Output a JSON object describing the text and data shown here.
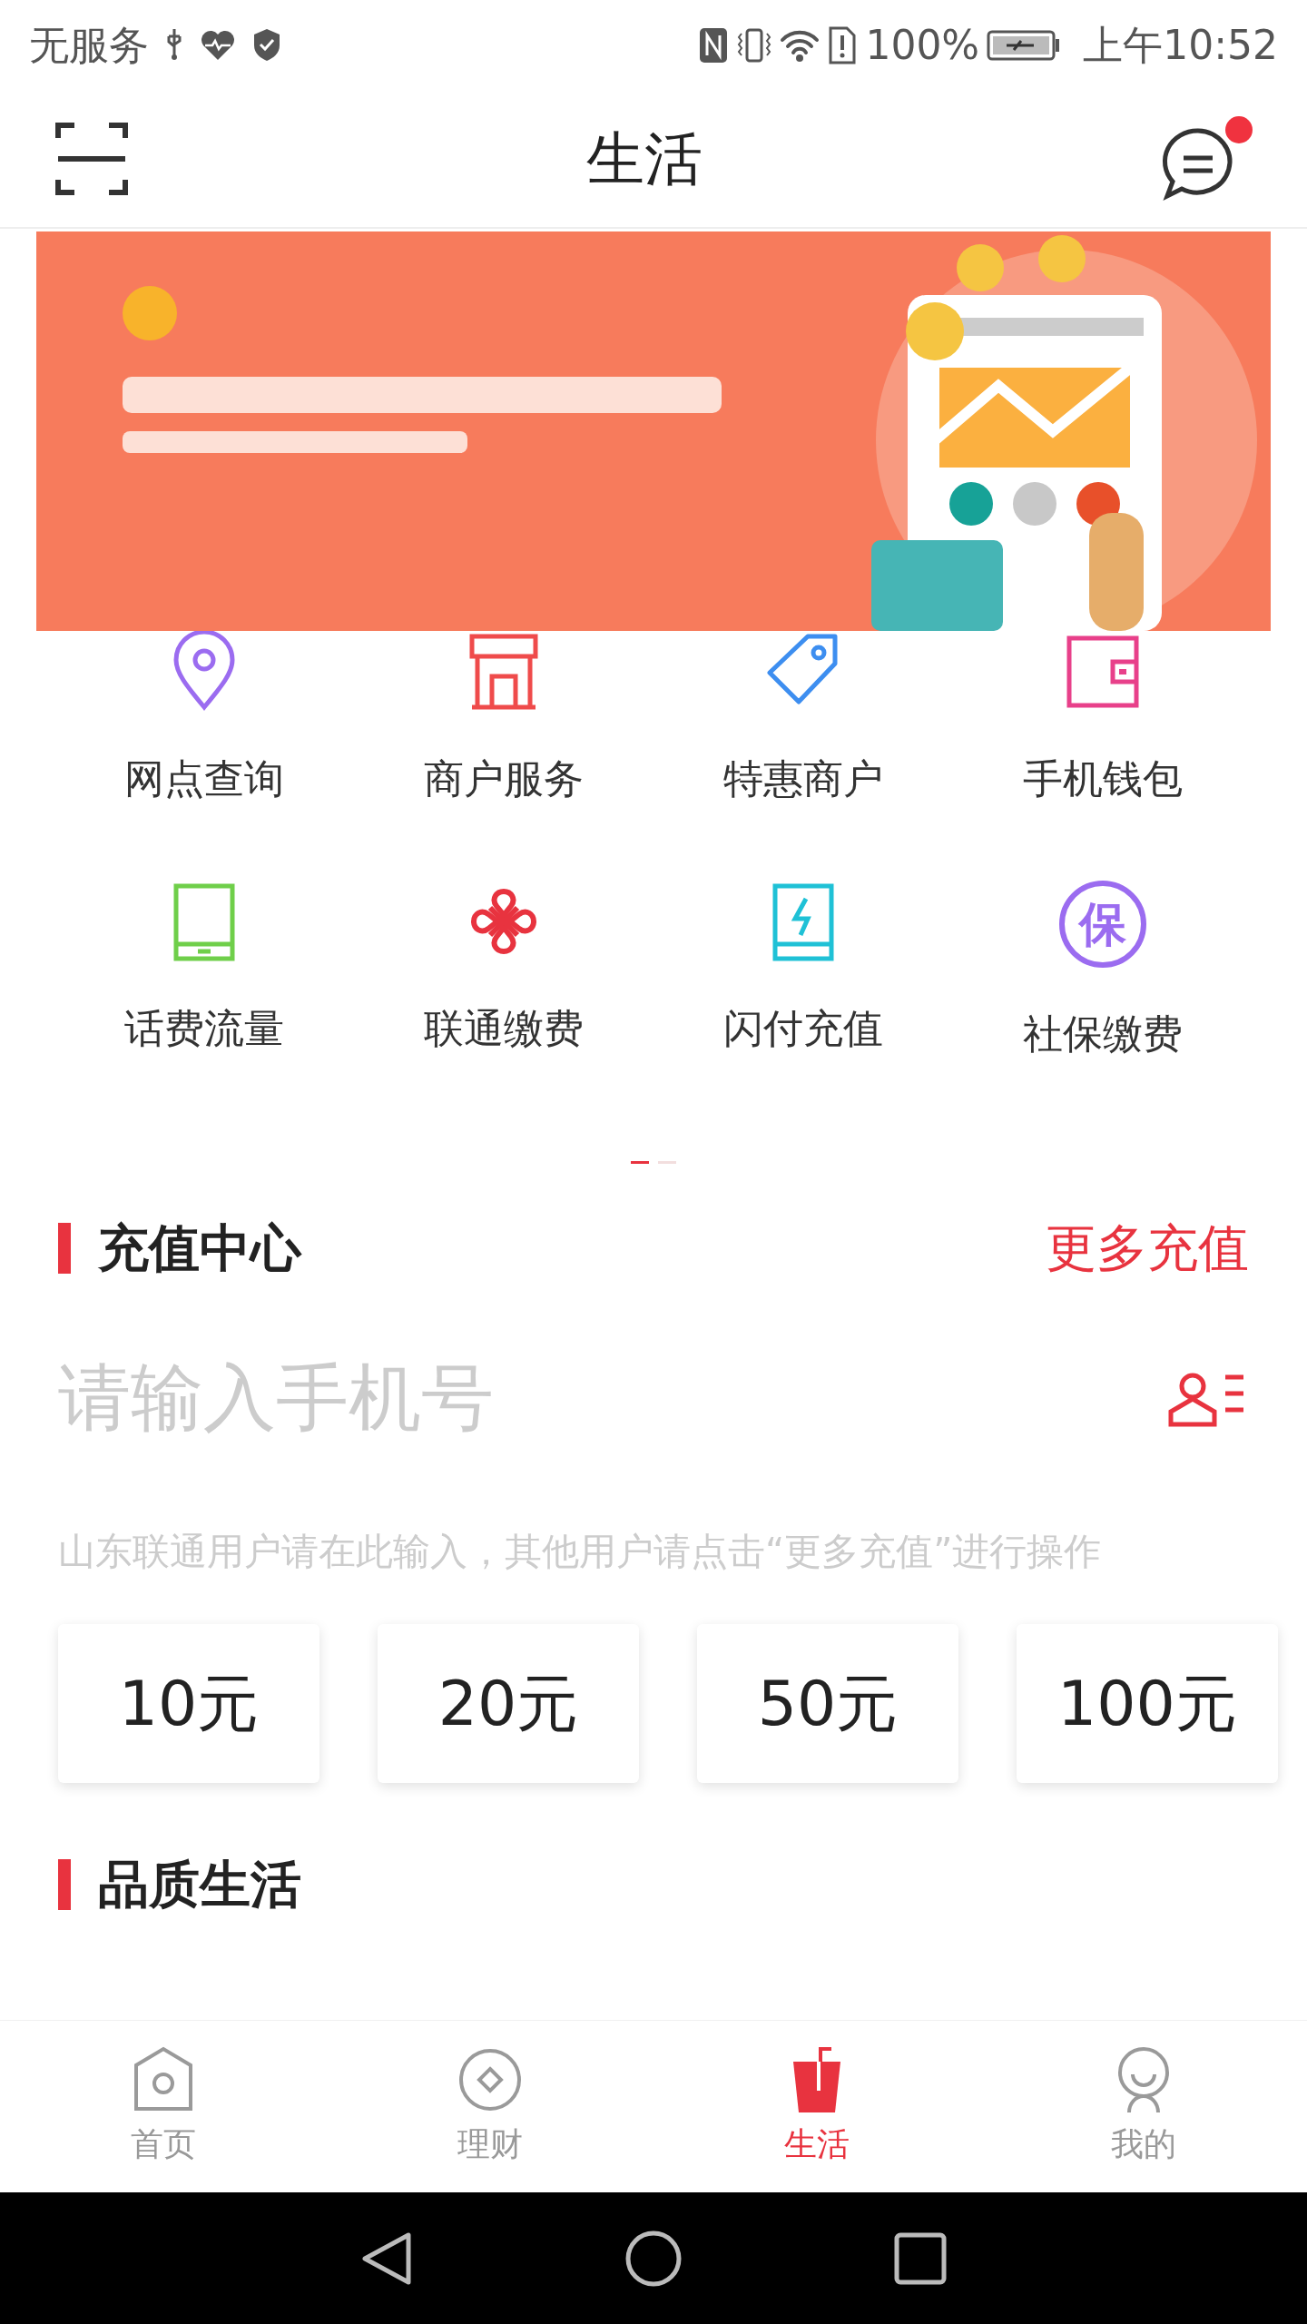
{
  "status_bar": {
    "carrier": "无服务",
    "battery": "100%",
    "time": "上午10:52"
  },
  "header": {
    "title": "生活",
    "has_unread": true
  },
  "services": [
    {
      "label": "网点查询",
      "kind": "pin",
      "color": "#9b6cf0"
    },
    {
      "label": "商户服务",
      "kind": "store",
      "color": "#ef4b4b"
    },
    {
      "label": "特惠商户",
      "kind": "tag",
      "color": "#3d8ef0"
    },
    {
      "label": "手机钱包",
      "kind": "wallet",
      "color": "#e8408a"
    },
    {
      "label": "话费流量",
      "kind": "tablet",
      "color": "#6fcf4a"
    },
    {
      "label": "联通缴费",
      "kind": "knot",
      "color": "#e8333f"
    },
    {
      "label": "闪付充值",
      "kind": "bolt",
      "color": "#1fc1d6"
    },
    {
      "label": "社保缴费",
      "kind": "seal",
      "icon_text": "保",
      "color": "#9b6cf0"
    }
  ],
  "pager": [
    {
      "selected": true
    },
    {
      "selected": false
    }
  ],
  "recharge": {
    "title": "充值中心",
    "more": "更多充值",
    "placeholder": "请输入手机号",
    "hint": "山东联通用户请在此输入，其他用户请点击“更多充值”进行操作",
    "amounts": [
      "10元",
      "20元",
      "50元",
      "100元"
    ]
  },
  "next_section": {
    "title": "品质生活"
  },
  "tab_bar": [
    {
      "label": "首页",
      "kind": "home",
      "selected": false
    },
    {
      "label": "理财",
      "kind": "coin",
      "selected": false
    },
    {
      "label": "生活",
      "kind": "cup",
      "selected": true
    },
    {
      "label": "我的",
      "kind": "person",
      "selected": false
    }
  ]
}
